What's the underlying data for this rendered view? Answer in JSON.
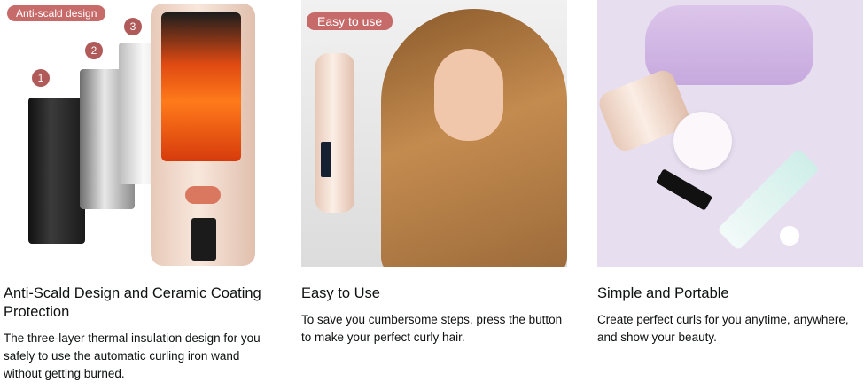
{
  "cards": [
    {
      "tag": "Anti-scald design",
      "layer_numbers": [
        "1",
        "2",
        "3"
      ],
      "heading": "Anti-Scald Design and Ceramic Coating Protection",
      "description": "The three-layer thermal insulation design for you safely to use the automatic curling iron wand without getting burned."
    },
    {
      "tag": "Easy to use",
      "heading": "Easy to Use",
      "description": "To save you cumbersome steps, press the button to make your perfect curly hair."
    },
    {
      "heading": "Simple and Portable",
      "description": "Create perfect curls for you anytime, anywhere, and show your beauty."
    }
  ],
  "colors": {
    "tag_background": "#c76a6a",
    "text": "#0f1111",
    "product_rose_gold": "#f8e7dc"
  }
}
